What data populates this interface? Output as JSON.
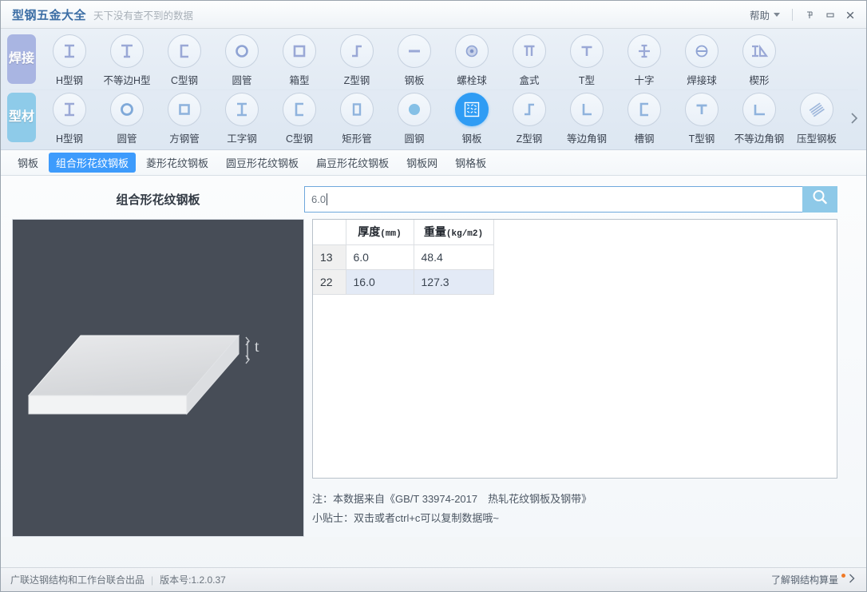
{
  "titlebar": {
    "app_title": "型钢五金大全",
    "subtitle": "天下没有查不到的数据",
    "help_label": "帮助",
    "caret_icon": "chevron-down-icon",
    "pin_icon": "pin-icon",
    "minimize_icon": "minimize-icon",
    "close_icon": "close-icon"
  },
  "ribbon": {
    "rows": [
      {
        "category": "焊接",
        "category_color": "#a9b5e2",
        "items": [
          {
            "label": "H型钢",
            "icon": "h-beam-icon"
          },
          {
            "label": "不等边H型",
            "icon": "unequal-h-beam-icon"
          },
          {
            "label": "C型钢",
            "icon": "c-channel-icon"
          },
          {
            "label": "圆管",
            "icon": "round-tube-icon"
          },
          {
            "label": "箱型",
            "icon": "box-section-icon"
          },
          {
            "label": "Z型钢",
            "icon": "z-section-icon"
          },
          {
            "label": "钢板",
            "icon": "steel-plate-icon"
          },
          {
            "label": "螺栓球",
            "icon": "bolt-ball-icon"
          },
          {
            "label": "盒式",
            "icon": "box-type-icon"
          },
          {
            "label": "T型",
            "icon": "t-section-icon"
          },
          {
            "label": "十字",
            "icon": "cross-section-icon"
          },
          {
            "label": "焊接球",
            "icon": "welded-ball-icon"
          },
          {
            "label": "楔形",
            "icon": "wedge-icon"
          }
        ]
      },
      {
        "category": "型材",
        "category_color": "#8ecbe9",
        "items": [
          {
            "label": "H型钢",
            "icon": "h-beam-icon"
          },
          {
            "label": "圆管",
            "icon": "round-tube-icon"
          },
          {
            "label": "方钢管",
            "icon": "square-tube-icon"
          },
          {
            "label": "工字钢",
            "icon": "i-beam-icon"
          },
          {
            "label": "C型钢",
            "icon": "c-channel-icon"
          },
          {
            "label": "矩形管",
            "icon": "rect-tube-icon"
          },
          {
            "label": "圆钢",
            "icon": "round-bar-icon"
          },
          {
            "label": "钢板",
            "icon": "patterned-plate-icon",
            "selected": true
          },
          {
            "label": "Z型钢",
            "icon": "z-section-icon"
          },
          {
            "label": "等边角钢",
            "icon": "equal-angle-icon"
          },
          {
            "label": "槽钢",
            "icon": "channel-icon"
          },
          {
            "label": "T型钢",
            "icon": "t-beam-icon"
          },
          {
            "label": "不等边角钢",
            "icon": "unequal-angle-icon"
          },
          {
            "label": "压型钢板",
            "icon": "profiled-sheet-icon"
          }
        ]
      }
    ],
    "scroll_right_icon": "chevron-right-icon"
  },
  "subtabs": [
    {
      "label": "钢板",
      "active": false
    },
    {
      "label": "组合形花纹钢板",
      "active": true
    },
    {
      "label": "菱形花纹钢板",
      "active": false
    },
    {
      "label": "圆豆形花纹钢板",
      "active": false
    },
    {
      "label": "扁豆形花纹钢板",
      "active": false
    },
    {
      "label": "钢板网",
      "active": false
    },
    {
      "label": "钢格板",
      "active": false
    }
  ],
  "panel": {
    "title": "组合形花纹钢板",
    "search_value": "6.0",
    "search_placeholder": "",
    "search_icon": "search-icon",
    "accent_color": "#3d9bfc",
    "search_button_color": "#8ec9e8"
  },
  "figure": {
    "name": "steel-plate-3d-diagram",
    "background_color": "#474d57",
    "dimension_label": "t"
  },
  "table": {
    "headers": [
      {
        "text": "厚度",
        "unit": "(mm)"
      },
      {
        "text": "重量",
        "unit": "(kg/m2)"
      }
    ],
    "rows": [
      {
        "index": "13",
        "thickness": "6.0",
        "weight": "48.4",
        "selected": false
      },
      {
        "index": "22",
        "thickness": "16.0",
        "weight": "127.3",
        "selected": true
      }
    ],
    "selected_row_color": "#e3eaf6"
  },
  "notes": [
    "注：本数据来自《GB/T 33974-2017　热轧花纹钢板及钢带》",
    "小贴士：双击或者ctrl+c可以复制数据哦~"
  ],
  "statusbar": {
    "producer": "广联达钢结构和工作台联合出品",
    "separator": "|",
    "version": "版本号:1.2.0.37",
    "link_label": "了解钢结构算量",
    "link_chevron_icon": "chevron-right-icon",
    "badge_color": "#f07a28"
  }
}
